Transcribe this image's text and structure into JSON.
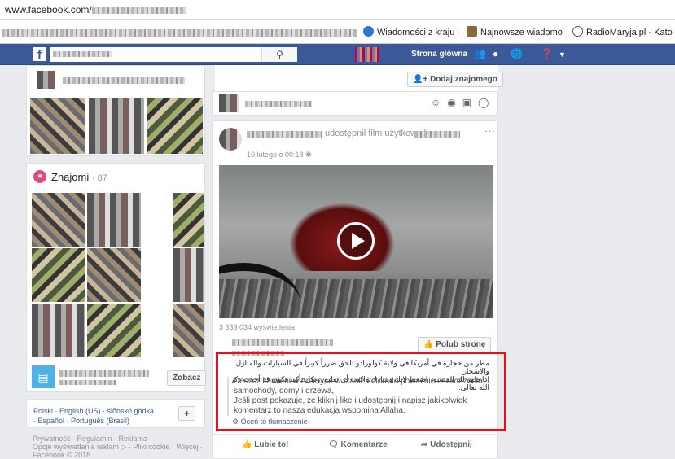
{
  "browser": {
    "url_domain": "www.facebook.com/",
    "bookmarks": [
      {
        "label": "Wiadomości z kraju i",
        "icon": "globe-icon"
      },
      {
        "label": "Najnowsze wiadomo",
        "icon": "news-icon"
      },
      {
        "label": "RadioMaryja.pl - Kato",
        "icon": "radio-icon"
      }
    ]
  },
  "topbar": {
    "logo": "f",
    "home_label": "Strona główna",
    "colors": {
      "brand": "#3b5998"
    }
  },
  "profile": {
    "add_friend_label": "Dodaj znajomego"
  },
  "friends": {
    "title": "Znajomi",
    "count": "· 87",
    "see_label": "Zobacz"
  },
  "footer_left": {
    "languages": "Polski · English (US) · ślōnskŏ gŏdka · Español · Português (Brasil)",
    "add": "+",
    "links_line1": "Prywatność · Regulamin · Reklama ·",
    "links_line2": "Opcje wyświetlania reklam ▷ · Pliki cookie · Więcej ·",
    "links_line3": "Facebook © 2018"
  },
  "post": {
    "shared_text": "udostępnił film użytkownika",
    "date": "10 lutego o 00:18 ·",
    "views": "3 339 034 wyświetlenia",
    "like_page_label": "Polub stronę",
    "arabic_line1": "مطر من حجارة في أمريكا في ولاية كولورادو تلحق ضرراً كبيراً في السيارات والمنازل والأشجار.",
    "arabic_line2": "إذا ظهر لك المنشور اضغط لايك وشارك واكتب أي تعليق وبكل تأكيد تكون قد أخذت ذكر الله تعالى.",
    "translation": "Deszcz kamieni w Ameryce w stanie kolorado poważnie uszkodzenia samochody, domy i drzewa,\nJeśli post pokazuje, że kliknij like i udostępnij i napisz jakikolwiek komentarz to nasza edukacja wspomina Allaha.",
    "rate_translation": "Oceń to tłumaczenie",
    "actions": {
      "like": "Lubię to!",
      "comment": "Komentarze",
      "share": "Udostępnij"
    }
  }
}
